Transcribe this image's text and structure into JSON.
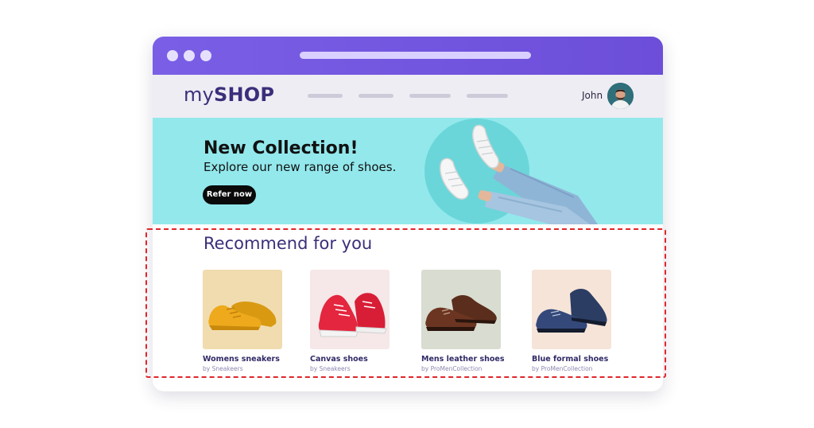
{
  "window": {
    "titlebar_color": "#7a5fe6"
  },
  "navbar": {
    "logo_prefix": "my",
    "logo_suffix": "SHOP",
    "user_name": "John"
  },
  "hero": {
    "title": "New Collection!",
    "subtitle": "Explore our new range of shoes.",
    "button_label": "Refer now",
    "background_color": "#93e8ec"
  },
  "recommend": {
    "title": "Recommend for you",
    "products": [
      {
        "name": "Womens sneakers",
        "by": "by Sneakeers",
        "bg": "#f1dcb0",
        "icon": "yellow-sneaker-icon"
      },
      {
        "name": "Canvas shoes",
        "by": "by Sneakeers",
        "bg": "#f6e7e8",
        "icon": "red-canvas-shoe-icon"
      },
      {
        "name": "Mens leather shoes",
        "by": "by ProMenCollection",
        "bg": "#d9dcd0",
        "icon": "brown-leather-shoe-icon"
      },
      {
        "name": "Blue formal shoes",
        "by": "by ProMenCollection",
        "bg": "#f6e4d8",
        "icon": "blue-formal-shoe-icon"
      }
    ],
    "highlight_color": "#e0262b"
  }
}
